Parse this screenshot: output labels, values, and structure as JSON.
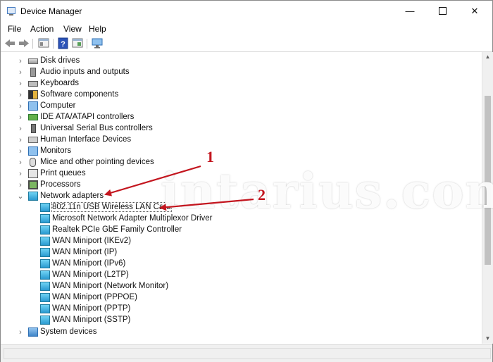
{
  "window": {
    "title": "Device Manager"
  },
  "titlebar_buttons": {
    "minimize": "—",
    "close": "✕"
  },
  "menu": [
    "File",
    "Action",
    "View",
    "Help"
  ],
  "tree": {
    "categories_top": [
      {
        "label": "Disk drives",
        "icon": "disk-drive-icon"
      },
      {
        "label": "Audio inputs and outputs",
        "icon": "speaker-icon"
      },
      {
        "label": "Keyboards",
        "icon": "keyboard-icon"
      },
      {
        "label": "Software components",
        "icon": "software-component-icon"
      },
      {
        "label": "Computer",
        "icon": "computer-icon"
      },
      {
        "label": "IDE ATA/ATAPI controllers",
        "icon": "ide-controller-icon"
      },
      {
        "label": "Universal Serial Bus controllers",
        "icon": "usb-icon"
      },
      {
        "label": "Human Interface Devices",
        "icon": "hid-icon"
      },
      {
        "label": "Monitors",
        "icon": "monitor-icon"
      },
      {
        "label": "Mice and other pointing devices",
        "icon": "mouse-icon"
      },
      {
        "label": "Print queues",
        "icon": "printer-icon"
      },
      {
        "label": "Processors",
        "icon": "processor-icon"
      }
    ],
    "network_adapters": {
      "label": "Network adapters",
      "icon": "network-adapter-icon",
      "expanded": true,
      "children": [
        "802.11n USB Wireless LAN Card",
        "Microsoft Network Adapter Multiplexor Driver",
        "Realtek PCIe GbE Family Controller",
        "WAN Miniport (IKEv2)",
        "WAN Miniport (IP)",
        "WAN Miniport (IPv6)",
        "WAN Miniport (L2TP)",
        "WAN Miniport (Network Monitor)",
        "WAN Miniport (PPPOE)",
        "WAN Miniport (PPTP)",
        "WAN Miniport (SSTP)"
      ]
    },
    "categories_bottom": [
      {
        "label": "System devices",
        "icon": "system-devices-icon"
      }
    ]
  },
  "annotations": {
    "marker_1": "1",
    "marker_2": "2",
    "color": "#c3151e"
  },
  "watermark": "intarius.com"
}
